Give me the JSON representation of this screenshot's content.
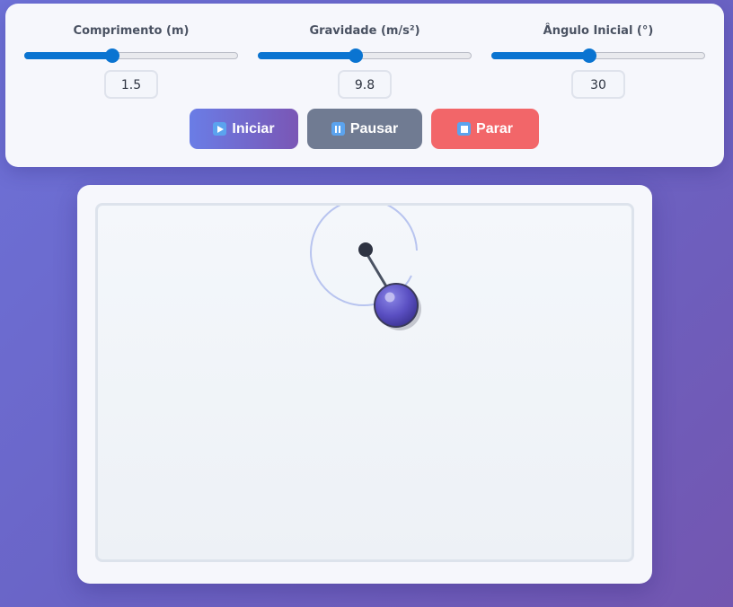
{
  "controls": {
    "length": {
      "label": "Comprimento (m)",
      "value": "1.5",
      "fraction": 0.41
    },
    "gravity": {
      "label": "Gravidade (m/s²)",
      "value": "9.8",
      "fraction": 0.46
    },
    "angle": {
      "label": "Ângulo Inicial (°)",
      "value": "30",
      "fraction": 0.46
    }
  },
  "buttons": {
    "start": "Iniciar",
    "pause": "Pausar",
    "stop": "Parar"
  },
  "icons": {
    "start": "play-icon",
    "pause": "pause-icon",
    "stop": "stop-icon"
  },
  "colors": {
    "accent": "#0a74d1",
    "start_from": "#6a7de6",
    "start_to": "#7a56b5",
    "pause": "#707b92",
    "stop": "#f26669",
    "bob": "#5a4fc2",
    "rod": "#4a5262",
    "trail": "#b8c4ef"
  }
}
